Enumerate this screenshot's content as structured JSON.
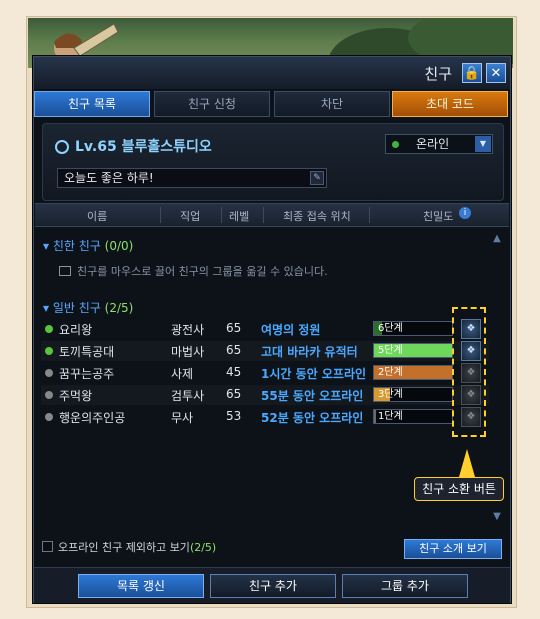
{
  "window": {
    "title": "친구"
  },
  "tabs": [
    {
      "label": "친구 목록",
      "active": true
    },
    {
      "label": "친구 신청",
      "active": false
    },
    {
      "label": "차단",
      "active": false
    },
    {
      "label": "초대 코드",
      "active": false
    }
  ],
  "profile": {
    "level_name": "Lv.65 블루홀스튜디오",
    "status": "온라인",
    "message": "오늘도 좋은 하루!"
  },
  "columns": [
    "이름",
    "직업",
    "레벨",
    "최종 접속 위치",
    "친밀도"
  ],
  "groups": {
    "close": {
      "label": "친한 친구",
      "count": "(0/0)",
      "hint": "친구를 마우스로 끌어 친구의 그룹을 옮길 수 있습니다."
    },
    "general": {
      "label": "일반 친구",
      "count": "(2/5)"
    }
  },
  "friends": [
    {
      "name": "요리왕",
      "job": "광전사",
      "level": "65",
      "location": "여명의 정원",
      "intimacy": "6단계",
      "online": true,
      "fill_color": "#2c6d2a",
      "fill_fraction": 0.1
    },
    {
      "name": "토끼특공대",
      "job": "마법사",
      "level": "65",
      "location": "고대 바라카 유적터",
      "intimacy": "5단계",
      "online": true,
      "fill_color": "#6fd85a",
      "fill_fraction": 1.0
    },
    {
      "name": "꿈꾸는공주",
      "job": "사제",
      "level": "45",
      "location": "1시간 동안 오프라인",
      "intimacy": "2단계",
      "online": false,
      "fill_color": "#c2702a",
      "fill_fraction": 1.0
    },
    {
      "name": "주먹왕",
      "job": "검투사",
      "level": "65",
      "location": "55분 동안 오프라인",
      "intimacy": "3단계",
      "online": false,
      "fill_color": "#d79a30",
      "fill_fraction": 0.2
    },
    {
      "name": "행운의주인공",
      "job": "무사",
      "level": "53",
      "location": "52분 동안 오프라인",
      "intimacy": "1단계",
      "online": false,
      "fill_color": "#6a6a6a",
      "fill_fraction": 0.02
    }
  ],
  "footer": {
    "checkbox_label": "오프라인 친구 제외하고 보기",
    "checkbox_count": "(2/5)",
    "intro_button": "친구 소개 보기"
  },
  "buttons": {
    "refresh": "목록 갱신",
    "add_friend": "친구 추가",
    "add_group": "그룹 추가"
  },
  "annotation": {
    "label": "친구 소환 버튼"
  },
  "colors": {
    "accent": "#2d79d6",
    "online": "#3fb53f",
    "highlight": "#ffcf2e"
  }
}
